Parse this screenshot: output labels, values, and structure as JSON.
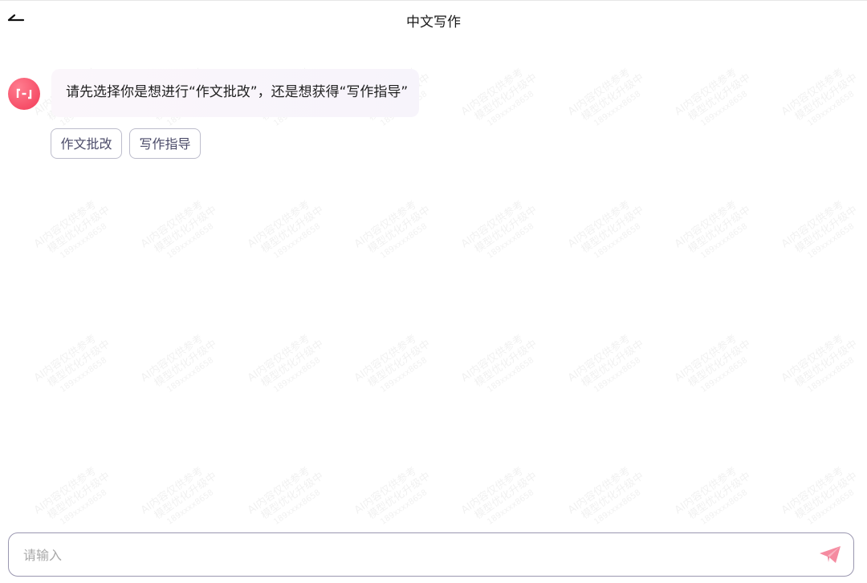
{
  "header": {
    "title": "中文写作",
    "back_icon": "back-arrow-icon"
  },
  "chat": {
    "bot_avatar_icon": "bracket-logo-icon",
    "message": "请先选择你是想进行“作文批改”，还是想获得“写作指导”",
    "options": [
      "作文批改",
      "写作指导"
    ]
  },
  "input": {
    "placeholder": "请输入",
    "value": "",
    "send_icon": "paper-plane-icon"
  },
  "watermark": {
    "line1": "AI内容仅供参考",
    "line2": "模型优化升级中",
    "line3": "189xxxx8658"
  },
  "colors": {
    "avatar": "#f23a57",
    "send_icon": "#f58ba0",
    "option_border": "#bdbdcc"
  }
}
